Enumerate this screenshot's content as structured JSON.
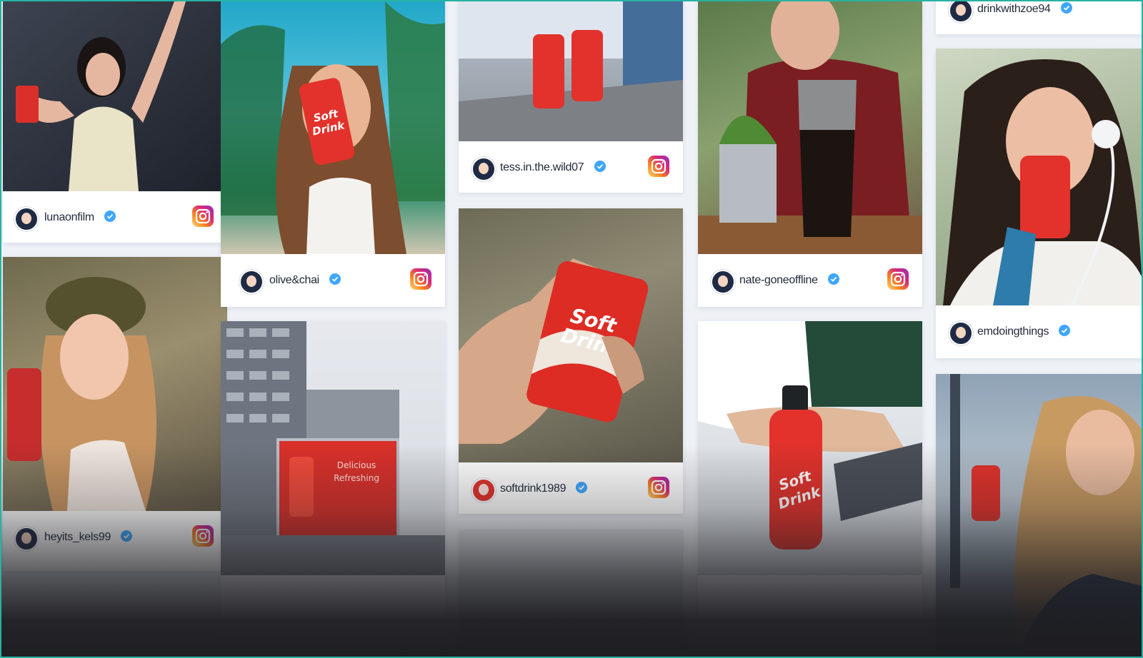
{
  "brand": {
    "can_text_line1": "Soft",
    "can_text_line2": "Drink",
    "billboard_text_line1": "Delicious",
    "billboard_text_line2": "Refreshing",
    "accent_red": "#e2322b",
    "instagram_gradient": [
      "#feda75",
      "#fa7e1e",
      "#d62976",
      "#962fbf"
    ],
    "verified_blue": "#3ea6ff"
  },
  "feed": {
    "posts": [
      {
        "username": "lunaonfilm",
        "icon": "instagram-icon"
      },
      {
        "username": "heyits_kels99",
        "icon": "instagram-icon"
      },
      {
        "username": "olive&chai",
        "icon": "instagram-icon"
      },
      {
        "username": "tess.in.the.wild07",
        "icon": "instagram-icon"
      },
      {
        "username": "softdrink1989",
        "icon": "instagram-icon"
      },
      {
        "username": "nate-goneoffline",
        "icon": "instagram-icon"
      },
      {
        "username": "drinkwithzoe94",
        "icon": "instagram-icon"
      },
      {
        "username": "emdoingthings",
        "icon": "instagram-icon"
      }
    ]
  }
}
